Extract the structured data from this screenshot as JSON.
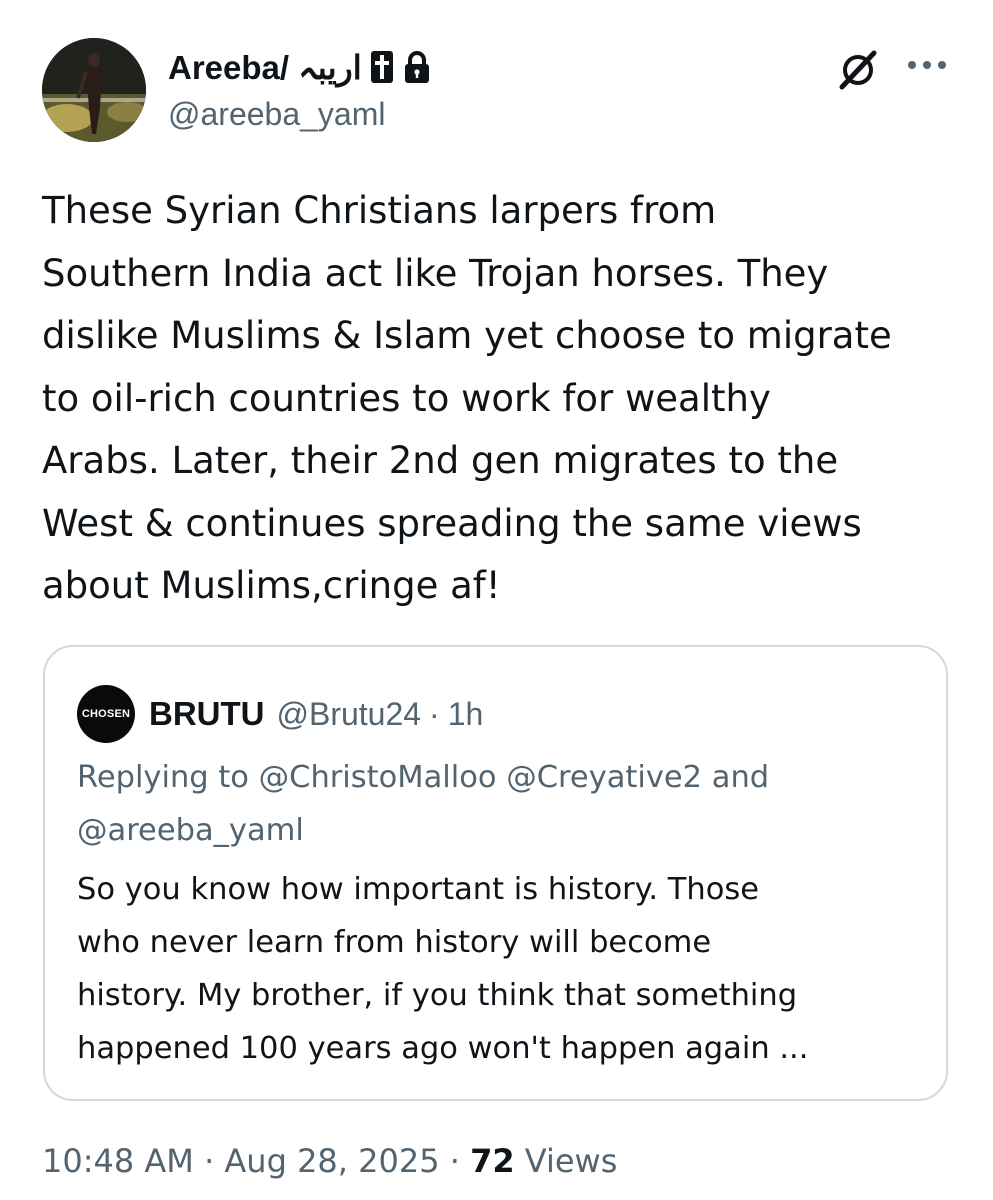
{
  "author": {
    "display_name": "Areeba/ اریبہ",
    "handle": "@areeba_yaml"
  },
  "icons": {
    "cross": "latin-cross-icon",
    "lock": "lock-icon",
    "grok": "grok-icon",
    "more": "more-horizontal-icon"
  },
  "tweet": {
    "lines": [
      "These Syrian Christians larpers from",
      "Southern India act like Trojan horses. They",
      "dislike Muslims & Islam yet choose to migrate",
      "to oil-rich countries to work for wealthy",
      "Arabs. Later, their 2nd gen migrates to the",
      "West & continues spreading the same views",
      "about Muslims,cringe af!"
    ]
  },
  "quote": {
    "avatar_text": "CHOSEN",
    "name": "BRUTU",
    "handle": "@Brutu24",
    "separator": "·",
    "time": "1h",
    "replying_lines": [
      "Replying to @ChristoMalloo @Creyative2 and",
      "@areeba_yaml"
    ],
    "text_lines": [
      "So you know how important is history. Those",
      "who never learn from history will become",
      "history. My brother, if you think that something",
      "happened 100 years ago won't happen again ..."
    ]
  },
  "footer": {
    "time": "10:48 AM",
    "separator": "·",
    "date": "Aug 28, 2025",
    "views_count": "72",
    "views_label": "Views"
  },
  "colors": {
    "text": "#0f1419",
    "secondary": "#536471",
    "border": "#cfd9de"
  }
}
